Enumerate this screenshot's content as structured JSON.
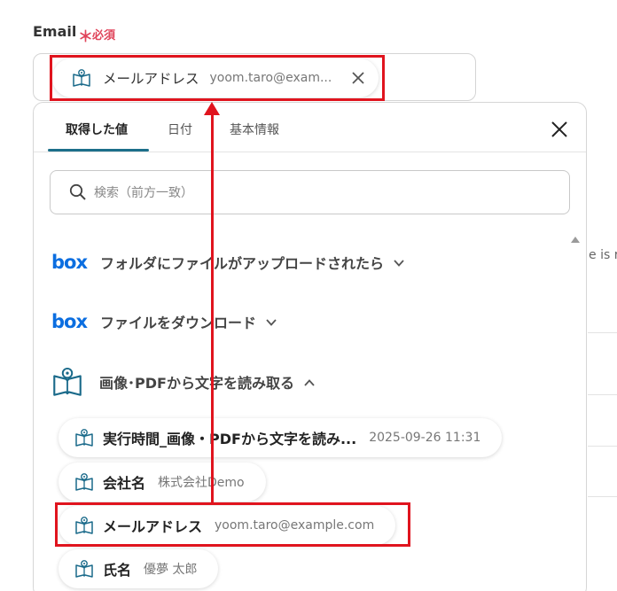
{
  "field": {
    "label": "Email",
    "required_mark": "＊",
    "required_text": "必須"
  },
  "selected_chip": {
    "name": "メールアドレス",
    "value": "yoom.taro@exam..."
  },
  "panel": {
    "tabs": [
      {
        "label": "取得した値",
        "active": true
      },
      {
        "label": "日付",
        "active": false
      },
      {
        "label": "基本情報",
        "active": false
      }
    ],
    "search_placeholder": "検索（前方一致）",
    "sections": [
      {
        "logo": "box",
        "label": "フォルダにファイルがアップロードされたら",
        "expanded": false
      },
      {
        "logo": "box",
        "label": "ファイルをダウンロード",
        "expanded": false
      },
      {
        "logo": "book-icon",
        "label": "画像･PDFから文字を読み取る",
        "expanded": true
      }
    ],
    "outputs": [
      {
        "name": "実行時間_画像・PDFから文字を読み...",
        "value": "2025-09-26 11:31"
      },
      {
        "name": "会社名",
        "value": "株式会社Demo"
      },
      {
        "name": "メールアドレス",
        "value": "yoom.taro@example.com"
      },
      {
        "name": "氏名",
        "value": "優夢 太郎"
      }
    ]
  },
  "background": {
    "right_fragment": "e is r"
  },
  "colors": {
    "highlight": "#e0141e",
    "required": "#e0445a",
    "tab_underline": "#1c6f8a",
    "box_brand": "#0b6ee0"
  }
}
